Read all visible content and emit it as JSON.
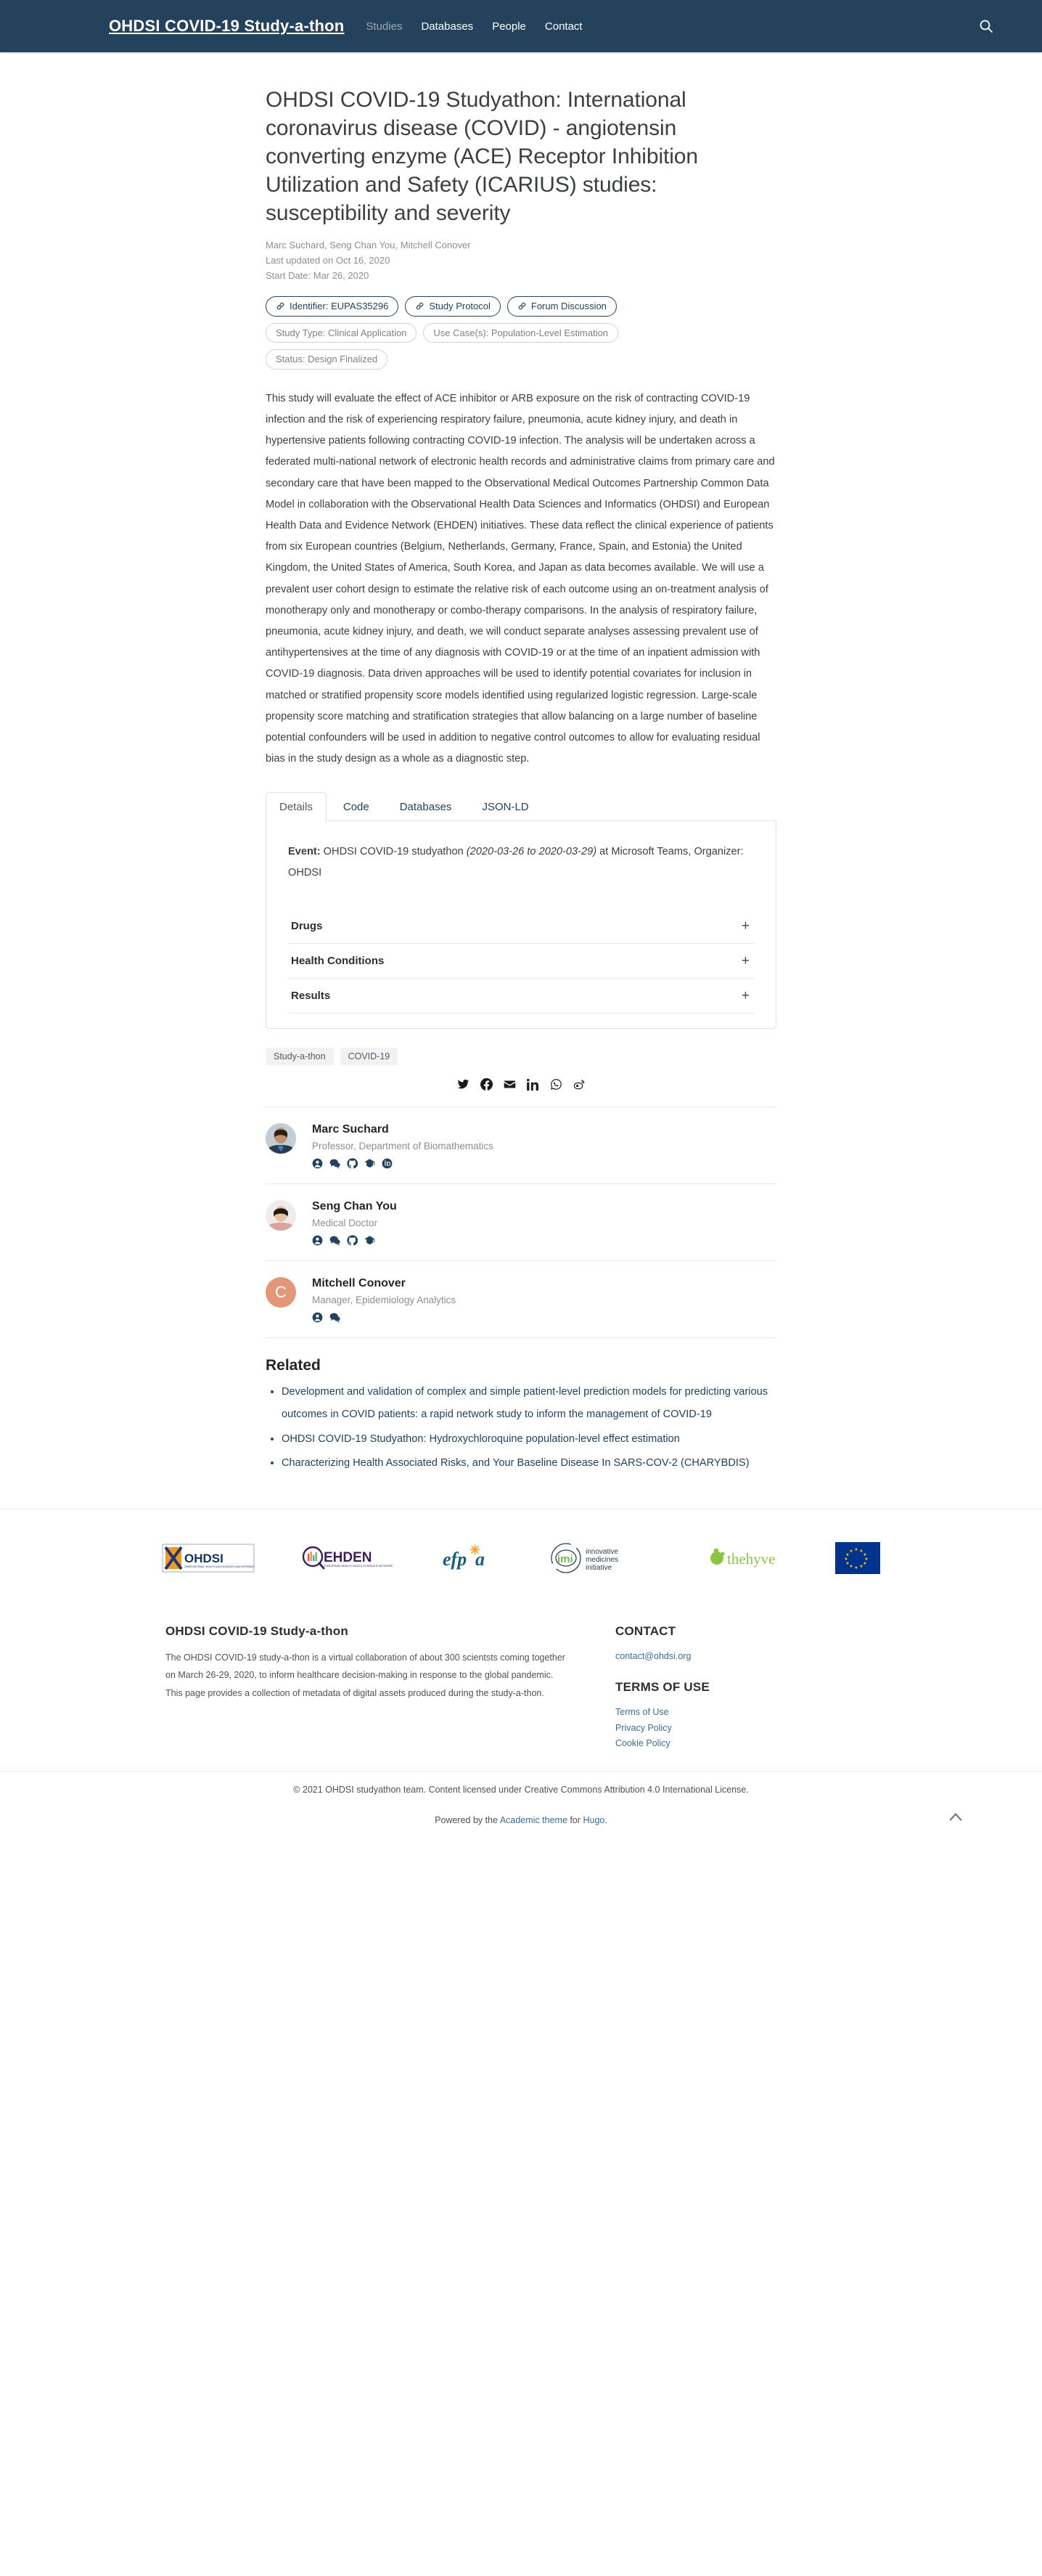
{
  "navbar": {
    "brand": "OHDSI COVID-19 Study-a-thon",
    "links": [
      {
        "label": "Studies",
        "active": true
      },
      {
        "label": "Databases",
        "active": false
      },
      {
        "label": "People",
        "active": false
      },
      {
        "label": "Contact",
        "active": false
      }
    ],
    "search_icon": "search-icon"
  },
  "article": {
    "title": "OHDSI COVID-19 Studyathon: International coronavirus disease (COVID) - angiotensin converting enzyme (ACE) Receptor Inhibition Utilization and Safety (ICARIUS) studies: susceptibility and severity",
    "authors_line": "Marc Suchard, Seng Chan You, Mitchell Conover",
    "last_updated": "Last updated on Oct 16, 2020",
    "start_date": "Start Date: Mar 26, 2020",
    "badges_row1": [
      {
        "label": "Identifier: EUPAS35296",
        "icon": "link-icon",
        "style": "link"
      },
      {
        "label": "Study Protocol",
        "icon": "link-icon",
        "style": "link"
      },
      {
        "label": "Forum Discussion",
        "icon": "link-icon",
        "style": "link"
      }
    ],
    "badges_row2": [
      {
        "label": "Study Type: Clinical Application",
        "style": "plain"
      },
      {
        "label": "Use Case(s): Population-Level Estimation",
        "style": "plain"
      }
    ],
    "badges_row3": [
      {
        "label": "Status: Design Finalized",
        "style": "plain"
      }
    ],
    "abstract": "This study will evaluate the effect of ACE inhibitor or ARB exposure on the risk of contracting COVID-19 infection and the risk of experiencing respiratory failure, pneumonia, acute kidney injury, and death in hypertensive patients following contracting COVID-19 infection. The analysis will be undertaken across a federated multi-national network of electronic health records and administrative claims from primary care and secondary care that have been mapped to the Observational Medical Outcomes Partnership Common Data Model in collaboration with the Observational Health Data Sciences and Informatics (OHDSI) and European Health Data and Evidence Network (EHDEN) initiatives. These data reflect the clinical experience of patients from six European countries (Belgium, Netherlands, Germany, France, Spain, and Estonia) the United Kingdom, the United States of America, South Korea, and Japan as data becomes available. We will use a prevalent user cohort design to estimate the relative risk of each outcome using an on-treatment analysis of monotherapy only and monotherapy or combo-therapy comparisons. In the analysis of respiratory failure, pneumonia, acute kidney injury, and death, we will conduct separate analyses assessing prevalent use of antihypertensives at the time of any diagnosis with COVID-19 or at the time of an inpatient admission with COVID-19 diagnosis. Data driven approaches will be used to identify potential covariates for inclusion in matched or stratified propensity score models identified using regularized logistic regression. Large-scale propensity score matching and stratification strategies that allow balancing on a large number of baseline potential confounders will be used in addition to negative control outcomes to allow for evaluating residual bias in the study design as a whole as a diagnostic step."
  },
  "tabs": [
    {
      "label": "Details",
      "active": true
    },
    {
      "label": "Code",
      "active": false
    },
    {
      "label": "Databases",
      "active": false
    },
    {
      "label": "JSON-LD",
      "active": false
    }
  ],
  "details_panel": {
    "event_label": "Event:",
    "event_name": "OHDSI COVID-19 studyathon",
    "event_dates": "(2020-03-26 to 2020-03-29)",
    "event_tail": "at Microsoft Teams, Organizer: OHDSI",
    "accordion": [
      {
        "title": "Drugs",
        "toggle": "+"
      },
      {
        "title": "Health Conditions",
        "toggle": "+"
      },
      {
        "title": "Results",
        "toggle": "+"
      }
    ]
  },
  "tags": [
    "Study-a-thon",
    "COVID-19"
  ],
  "share": [
    {
      "name": "twitter-icon"
    },
    {
      "name": "facebook-icon"
    },
    {
      "name": "email-icon"
    },
    {
      "name": "linkedin-icon"
    },
    {
      "name": "whatsapp-icon"
    },
    {
      "name": "weibo-icon"
    }
  ],
  "authors": [
    {
      "name": "Marc Suchard",
      "role": "Professor, Department of Biomathematics",
      "avatar_type": "photo-male",
      "avatar_color": "#5b6d7e",
      "initial": "",
      "icons": [
        "user-icon",
        "chat-icon",
        "github-icon",
        "google-scholar-icon",
        "orcid-icon"
      ]
    },
    {
      "name": "Seng Chan You",
      "role": "Medical Doctor",
      "avatar_type": "photo-female",
      "avatar_color": "#d6a090",
      "initial": "",
      "icons": [
        "user-icon",
        "chat-icon",
        "github-icon",
        "google-scholar-icon"
      ]
    },
    {
      "name": "Mitchell Conover",
      "role": "Manager, Epidemiology Analytics",
      "avatar_type": "initial",
      "avatar_color": "#e49678",
      "initial": "C",
      "icons": [
        "user-icon",
        "chat-icon"
      ]
    }
  ],
  "related": {
    "heading": "Related",
    "items": [
      "Development and validation of complex and simple patient-level prediction models for predicting various outcomes in COVID patients: a rapid network study to inform the management of COVID-19",
      "OHDSI COVID-19 Studyathon: Hydroxychloroquine population-level effect estimation",
      "Characterizing Health Associated Risks, and Your Baseline Disease In SARS-COV-2 (CHARYBDIS)"
    ]
  },
  "logos": [
    {
      "name": "ohdsi-logo",
      "text": "OHDSI",
      "sub": "OBSERVATIONAL HEALTH DATA SCIENCES AND INFORMATICS"
    },
    {
      "name": "ehden-logo",
      "text": "EHDEN",
      "sub": "EUROPEAN HEALTH DATA & EVIDENCE NETWORK"
    },
    {
      "name": "efpia-logo",
      "text": "efpia",
      "sub": ""
    },
    {
      "name": "imi-logo",
      "text": "imi",
      "sub": "innovative medicines initiative"
    },
    {
      "name": "thehyve-logo",
      "text": "thehyve",
      "sub": ""
    },
    {
      "name": "eu-flag-logo",
      "text": "",
      "sub": ""
    }
  ],
  "footer": {
    "left_heading": "OHDSI COVID-19 Study-a-thon",
    "left_text": "The OHDSI COVID-19 study-a-thon is a virtual collaboration of about 300 scientsts coming together on March 26-29, 2020, to inform healthcare decision-making in response to the global pandemic. This page provides a collection of metadata of digital assets produced during the study-a-thon.",
    "contact_heading": "CONTACT",
    "contact_email": "contact@ohdsi.org",
    "terms_heading": "TERMS OF USE",
    "terms_links": [
      "Terms of Use",
      "Privacy Policy",
      "Cookie Policy"
    ]
  },
  "copyright": "© 2021 OHDSI studyathon team. Content licensed under Creative Commons Attribution 4.0 International License.",
  "powered": {
    "prefix": "Powered by the ",
    "link1": "Academic theme",
    "middle": " for ",
    "link2": "Hugo",
    "suffix": ".",
    "back_to_top_icon": "chevron-up-icon"
  },
  "colors": {
    "navbar_bg": "#24425c",
    "accent": "#24425c",
    "link": "#3a6c94"
  }
}
